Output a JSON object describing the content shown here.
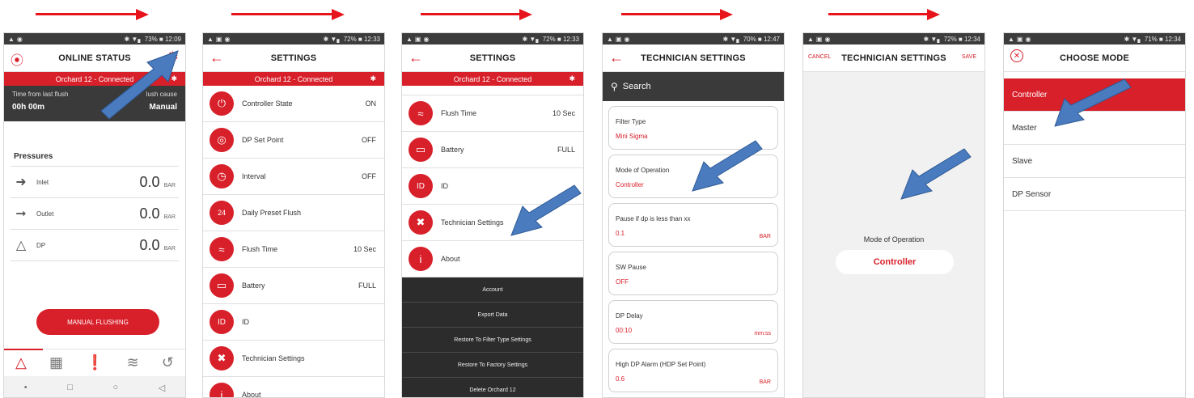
{
  "colors": {
    "brand_red": "#d8202a",
    "dark": "#3a3a3a",
    "callout_blue": "#4a7bbf"
  },
  "screen1": {
    "status": {
      "right": "✱ ▼▖ 73% ■ 12:09"
    },
    "title": "ONLINE STATUS",
    "connection": "Orchard 12 - Connected",
    "flush_time_label": "Time from last flush",
    "flush_time_value": "00h 00m",
    "flush_cause_label": "lush cause",
    "flush_cause_value": "Manual",
    "pressures_title": "Pressures",
    "pressures": [
      {
        "label": "Inlet",
        "value": "0.0",
        "unit": "BAR"
      },
      {
        "label": "Outlet",
        "value": "0.0",
        "unit": "BAR"
      },
      {
        "label": "DP",
        "value": "0.0",
        "unit": "BAR"
      }
    ],
    "manual_button": "MANUAL FLUSHING"
  },
  "screen2": {
    "status": {
      "right": "✱ ▼▖ 72% ■ 12:33"
    },
    "title": "SETTINGS",
    "connection": "Orchard 12 - Connected",
    "items": [
      {
        "label": "Controller State",
        "value": "ON"
      },
      {
        "label": "DP Set Point",
        "value": "OFF"
      },
      {
        "label": "Interval",
        "value": "OFF"
      },
      {
        "label": "Daily Preset Flush",
        "value": ""
      },
      {
        "label": "Flush Time",
        "value": "10 Sec"
      },
      {
        "label": "Battery",
        "value": "FULL"
      },
      {
        "label": "ID",
        "value": ""
      },
      {
        "label": "Technician Settings",
        "value": ""
      },
      {
        "label": "About",
        "value": ""
      }
    ]
  },
  "screen3": {
    "status": {
      "right": "✱ ▼▖ 72% ■ 12:33"
    },
    "title": "SETTINGS",
    "connection": "Orchard 12 - Connected",
    "items": [
      {
        "label": "Flush Time",
        "value": "10 Sec"
      },
      {
        "label": "Battery",
        "value": "FULL"
      },
      {
        "label": "ID",
        "value": ""
      },
      {
        "label": "Technician Settings",
        "value": ""
      },
      {
        "label": "About",
        "value": ""
      }
    ],
    "dark_items": [
      "Account",
      "Export Data",
      "Restore To Filter Type Settings",
      "Restore To Factory Settings",
      "Delete Orchard 12"
    ]
  },
  "screen4": {
    "status": {
      "right": "✱ ▼▖ 70% ■ 12:47"
    },
    "title": "TECHNICIAN SETTINGS",
    "search": "Search",
    "cards": [
      {
        "label": "Filter Type",
        "value": "Mini Sigma",
        "unit": ""
      },
      {
        "label": "Mode of Operation",
        "value": "Controller",
        "unit": ""
      },
      {
        "label": "Pause if dp is less than xx",
        "value": "0.1",
        "unit": "BAR"
      },
      {
        "label": "SW Pause",
        "value": "OFF",
        "unit": ""
      },
      {
        "label": "DP Delay",
        "value": "00:10",
        "unit": "mm:ss"
      },
      {
        "label": "High DP Alarm (HDP Set Point)",
        "value": "0.6",
        "unit": "BAR"
      }
    ]
  },
  "screen5": {
    "status": {
      "right": "✱ ▼▖ 72% ■ 12:34"
    },
    "title": "TECHNICIAN SETTINGS",
    "cancel": "CANCEL",
    "save": "SAVE",
    "mode_label": "Mode of Operation",
    "mode_value": "Controller"
  },
  "screen6": {
    "status": {
      "right": "✱ ▼▖ 71% ■ 12:34"
    },
    "title": "CHOOSE MODE",
    "options": [
      "Controller",
      "Master",
      "Slave",
      "DP Sensor"
    ]
  }
}
